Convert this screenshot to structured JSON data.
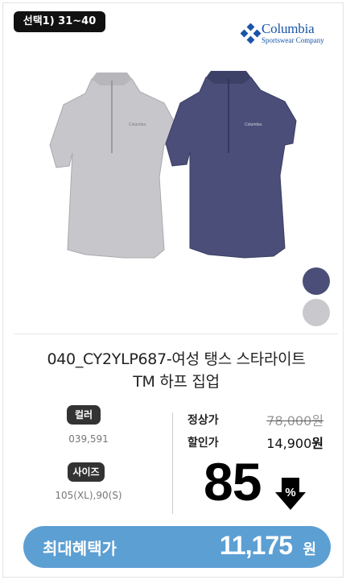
{
  "badge": {
    "label": "선택1) 31~40"
  },
  "brand": {
    "name": "Columbia",
    "subtitle": "Sportswear Company",
    "color": "#1a55a7"
  },
  "product": {
    "title_line1": "040_CY2YLP687-여성 탱스 스타라이트",
    "title_line2": "TM 하프 집업",
    "shirt_logo_text": "Columbia",
    "swatches": [
      "#4a4e78",
      "#c9c9cd"
    ]
  },
  "specs": {
    "color_label": "컬러",
    "color_value": "039,591",
    "size_label": "사이즈",
    "size_value": "105(XL),90(S)"
  },
  "price": {
    "regular_label": "정상가",
    "regular_value": "78,000원",
    "sale_label": "할인가",
    "sale_amount": "14,900",
    "sale_unit": "원",
    "discount": "85",
    "discount_symbol": "%"
  },
  "benefit": {
    "label": "최대혜택가",
    "amount": "11,175",
    "unit": "원",
    "color": "#5c9fd3"
  }
}
